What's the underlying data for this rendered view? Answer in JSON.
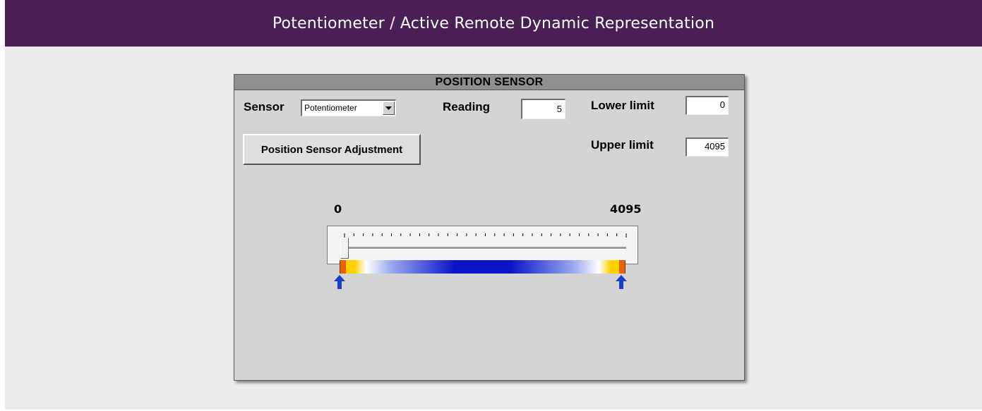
{
  "banner": {
    "title": "Potentiometer / Active Remote Dynamic Representation"
  },
  "window": {
    "title": "POSITION SENSOR",
    "sensor_label": "Sensor",
    "sensor_value": "Potentiometer",
    "reading_label": "Reading",
    "reading_value": "5",
    "lower_label": "Lower limit",
    "lower_value": "0",
    "upper_label": "Upper limit",
    "upper_value": "4095",
    "adjust_button": "Position Sensor Adjustment"
  },
  "slider": {
    "min_label": "0",
    "max_label": "4095",
    "min": 0,
    "max": 4095,
    "value": 5,
    "tick_count": 31,
    "lower_marker": 0,
    "upper_marker": 4095
  },
  "colors": {
    "banner": "#4a1f55",
    "arrow": "#1a3fc8",
    "bar_gradient": [
      "#e8600a",
      "#ffd000",
      "#ffffff",
      "#9aa8f0",
      "#0b15c8",
      "#0b15c8",
      "#9aa8f0",
      "#ffffff",
      "#ffd000",
      "#e8600a"
    ]
  },
  "icons": {
    "dropdown": "chevron-down-icon",
    "marker": "arrow-up-icon"
  }
}
